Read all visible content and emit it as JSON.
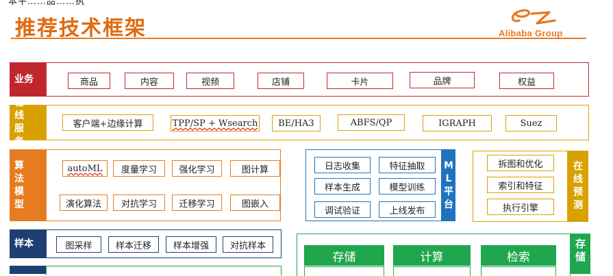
{
  "header": {
    "top_cut_text": "本平……品……执",
    "title": "推荐技术框架",
    "logo_text": "Alibaba Group"
  },
  "rows": {
    "business": {
      "label": "业务",
      "items": [
        "商品",
        "内容",
        "视频",
        "店铺",
        "卡片",
        "品牌",
        "权益"
      ]
    },
    "online": {
      "label": "在线服务",
      "items": [
        "客户端+边缘计算",
        "TPP/SP + Wsearch",
        "BE/HA3",
        "ABFS/QP",
        "IGRAPH",
        "Suez"
      ]
    },
    "algo": {
      "label": "算法模型",
      "items": [
        "autoML",
        "度量学习",
        "强化学习",
        "图计算",
        "演化算法",
        "对抗学习",
        "迁移学习",
        "图嵌入"
      ]
    },
    "ml": {
      "items": [
        "日志收集",
        "特征抽取",
        "样本生成",
        "模型训练",
        "调试验证",
        "上线发布"
      ],
      "side_label": "ML平台"
    },
    "predict": {
      "items": [
        "拆图和优化",
        "索引和特征",
        "执行引擎"
      ],
      "side_label": "在线预测"
    },
    "sample": {
      "label": "样本",
      "items": [
        "图采样",
        "样本迁移",
        "样本增强",
        "对抗样本"
      ]
    },
    "storage": {
      "heads": [
        "存储",
        "计算",
        "检索"
      ],
      "side_label": "存储"
    }
  },
  "colors": {
    "title": "#e06a10",
    "red": "#c0272d",
    "gold": "#d9a100",
    "orange": "#e57c22",
    "navy": "#1f3f73",
    "blue": "#1e73be",
    "green": "#20a64d"
  }
}
